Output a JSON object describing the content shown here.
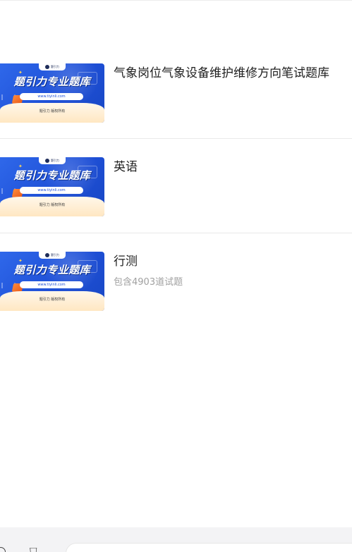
{
  "thumbnail": {
    "logo_text": "题引力",
    "headline": "题引力专业题库",
    "url": "www.tiyinli.com",
    "tagline": "题引力 版权所有"
  },
  "items": [
    {
      "title": "气象岗位气象设备维护维修方向笔试题库",
      "subtitle": ""
    },
    {
      "title": "英语",
      "subtitle": ""
    },
    {
      "title": "行测",
      "subtitle": "包含4903道试题"
    }
  ],
  "bottom_bar": {
    "icon_left": "search-icon",
    "icon_right": "cart-icon"
  }
}
